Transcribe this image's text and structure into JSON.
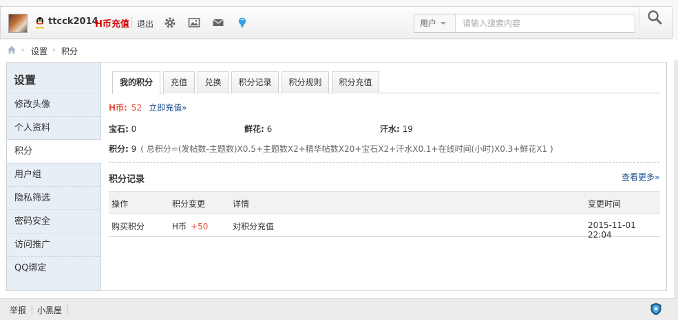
{
  "header": {
    "username": "ttcck2014",
    "recharge_label": "H币充值",
    "logout_label": "退出",
    "search": {
      "type_label": "用户",
      "placeholder": "请输入搜索内容"
    }
  },
  "breadcrumb": [
    "设置",
    "积分"
  ],
  "sidebar": {
    "title": "设置",
    "items": [
      "修改头像",
      "个人资料",
      "积分",
      "用户组",
      "隐私筛选",
      "密码安全",
      "访问推广",
      "QQ绑定"
    ],
    "active_index": 2
  },
  "tabs": [
    "我的积分",
    "充值",
    "兑换",
    "积分记录",
    "积分规则",
    "积分充值"
  ],
  "hcoin": {
    "label": "H币:",
    "value": "52",
    "recharge_now": "立即充值»"
  },
  "stats": [
    {
      "label": "宝石:",
      "value": "0"
    },
    {
      "label": "鲜花:",
      "value": "6"
    },
    {
      "label": "汗水:",
      "value": "19"
    }
  ],
  "score": {
    "label": "积分:",
    "value": "9",
    "formula": "( 总积分=(发帖数-主题数)X0.5+主题数X2+精华帖数X20+宝石X2+汗水X0.1+在线时间(小时)X0.3+鲜花X1 )"
  },
  "records": {
    "title": "积分记录",
    "view_more": "查看更多»",
    "columns": [
      "操作",
      "积分变更",
      "详情",
      "变更时间"
    ],
    "rows": [
      {
        "action": "购买积分",
        "currency": "H币",
        "change": "+50",
        "detail": "对积分充值",
        "time": "2015-11-01 22:04"
      }
    ]
  },
  "footer": {
    "links": [
      "举报",
      "小黑屋"
    ]
  },
  "colors": {
    "accent_red": "#d40000",
    "link_blue": "#1a4b8c",
    "sidebar_bg": "#e7eef6",
    "hcoin_orange": "#e0533a"
  }
}
